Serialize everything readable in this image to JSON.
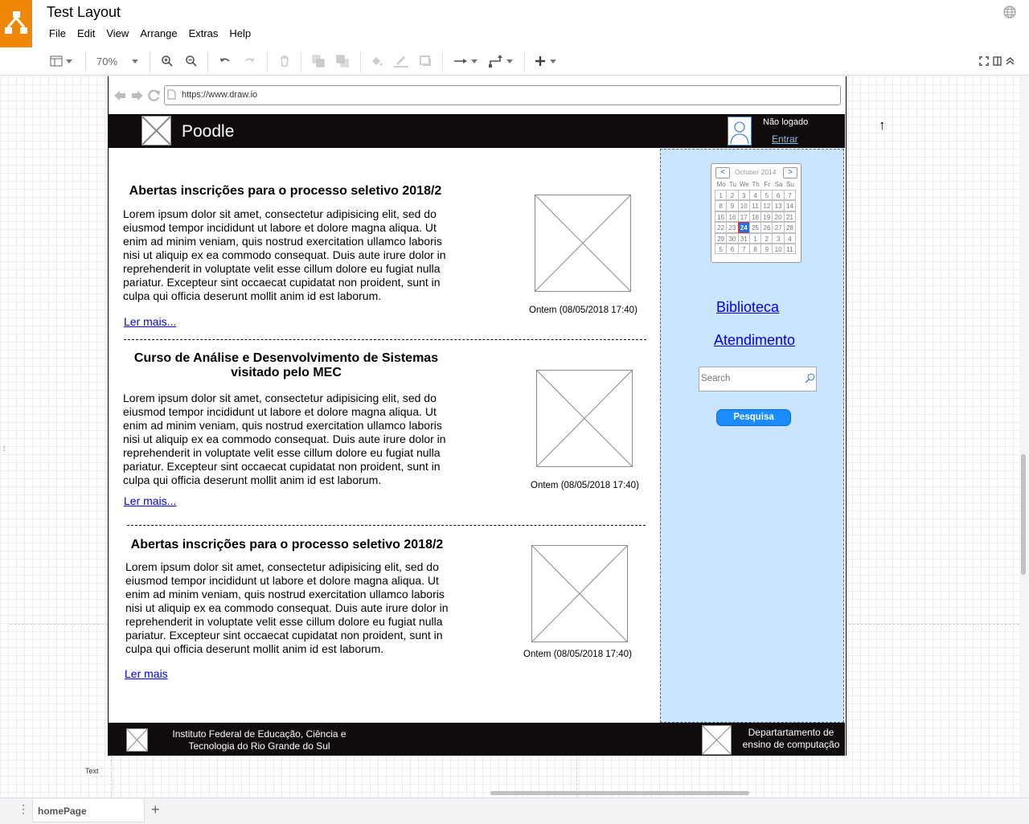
{
  "app": {
    "title": "Test Layout",
    "menu": [
      "File",
      "Edit",
      "View",
      "Arrange",
      "Extras",
      "Help"
    ],
    "zoom": "70%",
    "page_tab": "homePage"
  },
  "mockup": {
    "url": "https://www.draw.io",
    "site_name": "Poodle",
    "user_status": "Não logado",
    "login_link": "Entrar",
    "articles": [
      {
        "title": "Abertas inscrições para o processo seletivo 2018/2",
        "body": "Lorem ipsum dolor sit amet, consectetur adipisicing elit, sed do eiusmod tempor incididunt ut labore et dolore magna aliqua. Ut enim ad minim veniam, quis nostrud exercitation ullamco laboris nisi ut aliquip ex ea commodo consequat. Duis aute irure dolor in reprehenderit in voluptate velit esse cillum dolore eu fugiat nulla pariatur. Excepteur sint occaecat cupidatat non proident, sunt in culpa qui officia deserunt mollit anim id est laborum.",
        "date": "Ontem (08/05/2018 17:40)",
        "link": "Ler mais..."
      },
      {
        "title": "Curso de Análise e Desenvolvimento de Sistemas visitado pelo MEC",
        "body": "Lorem ipsum dolor sit amet, consectetur adipisicing elit, sed do eiusmod tempor incididunt ut labore et dolore magna aliqua. Ut enim ad minim veniam, quis nostrud exercitation ullamco laboris nisi ut aliquip ex ea commodo consequat. Duis aute irure dolor in reprehenderit in voluptate velit esse cillum dolore eu fugiat nulla pariatur. Excepteur sint occaecat cupidatat non proident, sunt in culpa qui officia deserunt mollit anim id est laborum.",
        "date": "Ontem (08/05/2018 17:40)",
        "link": "Ler mais..."
      },
      {
        "title": "Abertas inscrições para o processo seletivo 2018/2",
        "body": "Lorem ipsum dolor sit amet, consectetur adipisicing elit, sed do eiusmod tempor incididunt ut labore et dolore magna aliqua. Ut enim ad minim veniam, quis nostrud exercitation ullamco laboris nisi ut aliquip ex ea commodo consequat. Duis aute irure dolor in reprehenderit in voluptate velit esse cillum dolore eu fugiat nulla pariatur. Excepteur sint occaecat cupidatat non proident, sunt in culpa qui officia deserunt mollit anim id est laborum.",
        "date": "Ontem (08/05/2018 17:40)",
        "link": "Ler mais"
      }
    ],
    "calendar": {
      "month": "October 2014",
      "weekdays": [
        "Mo",
        "Tu",
        "We",
        "Th",
        "Fr",
        "Sa",
        "Su"
      ],
      "days": [
        "1",
        "2",
        "3",
        "4",
        "5",
        "6",
        "7",
        "8",
        "9",
        "10",
        "11",
        "12",
        "13",
        "14",
        "15",
        "16",
        "17",
        "18",
        "19",
        "20",
        "21",
        "22",
        "23",
        "24",
        "25",
        "26",
        "27",
        "28",
        "29",
        "30",
        "31",
        "1",
        "2",
        "3",
        "4",
        "5",
        "6",
        "7",
        "8",
        "9",
        "10",
        "11"
      ],
      "selected": "24"
    },
    "sidebar_links": [
      "Biblioteca",
      "Atendimento"
    ],
    "search_placeholder": "Search",
    "search_button": "Pesquisa",
    "footer_left": "Instituto Federal de Educação, Ciência e Tecnologia do Rio Grande do Sul",
    "footer_right": "Departartamento de ensino de computação"
  },
  "canvas_label": "Text"
}
